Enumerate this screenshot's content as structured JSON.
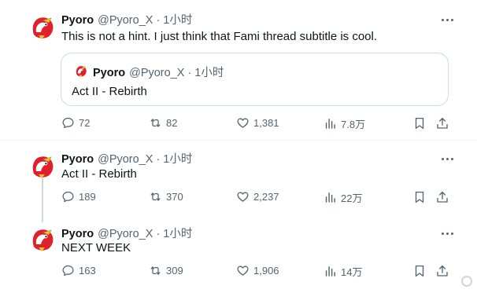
{
  "tweets": [
    {
      "name": "Pyoro",
      "handle": "@Pyoro_X",
      "dot": "·",
      "time": "1小时",
      "text": "This is not a hint. I just think that Fami thread subtitle is cool.",
      "quote": {
        "name": "Pyoro",
        "handle": "@Pyoro_X",
        "dot": "·",
        "time": "1小时",
        "text": "Act II - Rebirth"
      },
      "replies": "72",
      "retweets": "82",
      "likes": "1,381",
      "views": "7.8万"
    },
    {
      "name": "Pyoro",
      "handle": "@Pyoro_X",
      "dot": "·",
      "time": "1小时",
      "text": "Act II - Rebirth",
      "replies": "189",
      "retweets": "370",
      "likes": "2,237",
      "views": "22万"
    },
    {
      "name": "Pyoro",
      "handle": "@Pyoro_X",
      "dot": "·",
      "time": "1小时",
      "text": "NEXT WEEK",
      "replies": "163",
      "retweets": "309",
      "likes": "1,906",
      "views": "14万"
    }
  ],
  "icons": {
    "reply": "reply-icon",
    "retweet": "retweet-icon",
    "like": "heart-icon",
    "views": "views-icon",
    "bookmark": "bookmark-icon",
    "share": "share-icon",
    "more": "more-icon"
  },
  "colors": {
    "text": "#0f1419",
    "secondary": "#536471",
    "border": "#cfd9de",
    "avatar_red": "#e0202c"
  }
}
